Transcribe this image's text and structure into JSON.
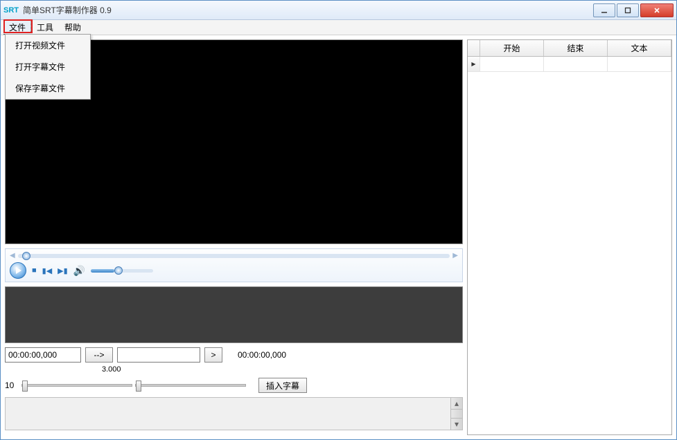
{
  "title": "简单SRT字幕制作器 0.9",
  "srt_icon": "SRT",
  "menu": {
    "file": "文件",
    "tool": "工具",
    "help": "帮助"
  },
  "dropdown": {
    "open_video": "打开视频文件",
    "open_subtitle": "打开字幕文件",
    "save_subtitle": "保存字幕文件"
  },
  "timecode_in": "00:00:00,000",
  "arrow_btn": "-->",
  "out_btn": ">",
  "timecode_display": "00:00:00,000",
  "offset_value": "3.000",
  "scale_label": "10",
  "insert_btn": "插入字幕",
  "grid_headers": {
    "start": "开始",
    "end": "结束",
    "text": "文本"
  }
}
